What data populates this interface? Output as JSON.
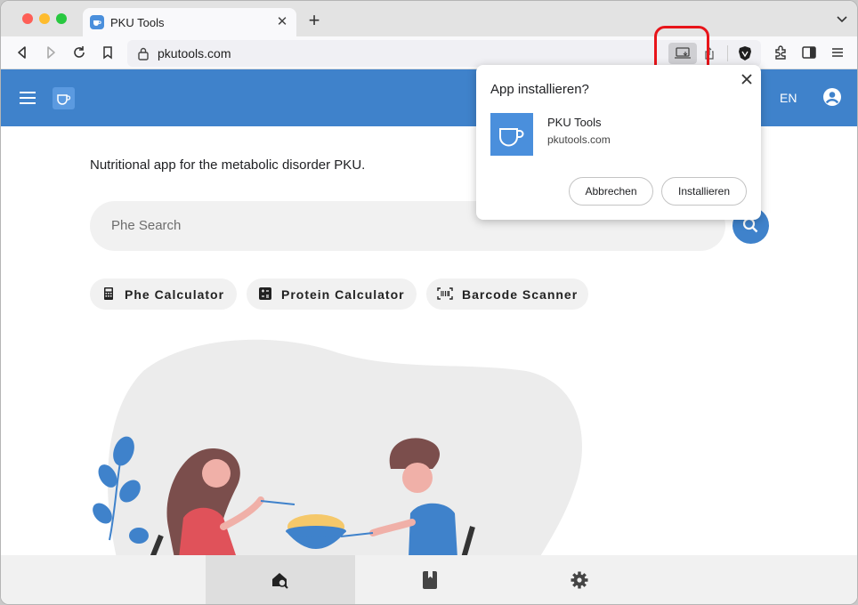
{
  "browser": {
    "tab_title": "PKU Tools",
    "url": "pkutools.com"
  },
  "install_popup": {
    "title": "App installieren?",
    "app_name": "PKU Tools",
    "app_origin": "pkutools.com",
    "cancel_label": "Abbrechen",
    "install_label": "Installieren"
  },
  "appbar": {
    "language": "EN"
  },
  "main": {
    "tagline": "Nutritional app for the metabolic disorder PKU.",
    "search_placeholder": "Phe Search",
    "chips": [
      {
        "label": "Phe Calculator",
        "icon": "calculator-icon"
      },
      {
        "label": "Protein Calculator",
        "icon": "calculator-grid-icon"
      },
      {
        "label": "Barcode Scanner",
        "icon": "barcode-icon"
      }
    ]
  },
  "bottom_nav": [
    {
      "icon": "home-search-icon",
      "active": true
    },
    {
      "icon": "book-icon",
      "active": false
    },
    {
      "icon": "gear-icon",
      "active": false
    }
  ],
  "colors": {
    "brand": "#3f82cb",
    "highlight": "#e8141a"
  }
}
